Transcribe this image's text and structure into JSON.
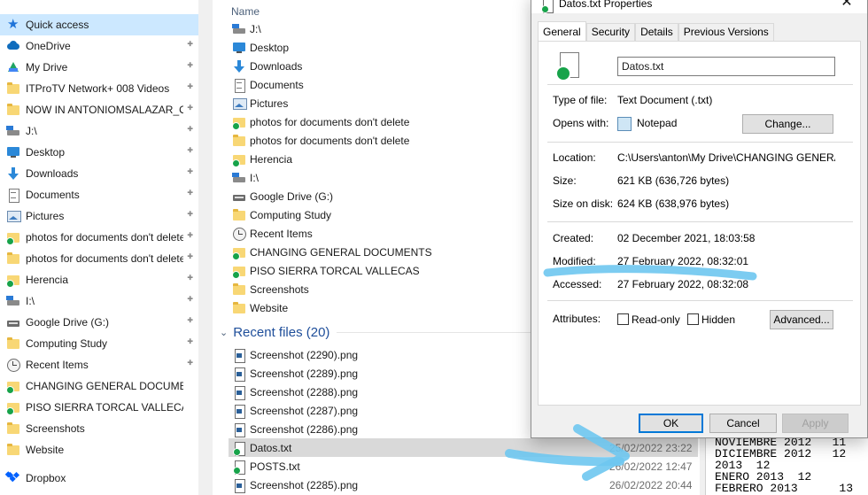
{
  "nav": {
    "items": [
      {
        "label": "Quick access",
        "icon": "star-icon",
        "pinned": false
      },
      {
        "label": "OneDrive",
        "icon": "onedrive-icon",
        "pinned": true
      },
      {
        "label": "My Drive",
        "icon": "google-drive-icon",
        "pinned": true
      },
      {
        "label": "ITProTV Network+ 008 Videos",
        "icon": "folder-icon",
        "pinned": true
      },
      {
        "label": "NOW IN ANTONIOMSALAZAR_OUTLOOK",
        "icon": "folder-icon",
        "pinned": true
      },
      {
        "label": "J:\\",
        "icon": "drive-icon",
        "pinned": true
      },
      {
        "label": "Desktop",
        "icon": "desktop-icon",
        "pinned": true
      },
      {
        "label": "Downloads",
        "icon": "downloads-icon",
        "pinned": true
      },
      {
        "label": "Documents",
        "icon": "documents-icon",
        "pinned": true
      },
      {
        "label": "Pictures",
        "icon": "pictures-icon",
        "pinned": true
      },
      {
        "label": "photos for documents don't delete",
        "icon": "synced-folder-icon",
        "pinned": true
      },
      {
        "label": "photos for documents don't delete",
        "icon": "folder-icon",
        "pinned": true
      },
      {
        "label": "Herencia",
        "icon": "synced-folder-icon",
        "pinned": true
      },
      {
        "label": "I:\\",
        "icon": "drive-icon",
        "pinned": true
      },
      {
        "label": "Google Drive (G:)",
        "icon": "google-drive-disk-icon",
        "pinned": true
      },
      {
        "label": "Computing Study",
        "icon": "folder-icon",
        "pinned": true
      },
      {
        "label": "Recent Items",
        "icon": "recent-items-icon",
        "pinned": true
      },
      {
        "label": "CHANGING GENERAL DOCUMENTS",
        "icon": "synced-folder-icon",
        "pinned": false
      },
      {
        "label": "PISO SIERRA TORCAL VALLECAS",
        "icon": "synced-folder-icon",
        "pinned": false
      },
      {
        "label": "Screenshots",
        "icon": "folder-icon",
        "pinned": false
      },
      {
        "label": "Website",
        "icon": "folder-icon",
        "pinned": false
      },
      {
        "label": "Dropbox",
        "icon": "dropbox-icon",
        "pinned": false
      }
    ]
  },
  "files": {
    "column_name": "Name",
    "frequent": [
      {
        "name": "J:\\",
        "icon": "drive-icon"
      },
      {
        "name": "Desktop",
        "icon": "desktop-icon"
      },
      {
        "name": "Downloads",
        "icon": "downloads-icon"
      },
      {
        "name": "Documents",
        "icon": "documents-icon"
      },
      {
        "name": "Pictures",
        "icon": "pictures-icon"
      },
      {
        "name": "photos for documents don't delete",
        "icon": "synced-folder-icon"
      },
      {
        "name": "photos for documents don't delete",
        "icon": "folder-icon"
      },
      {
        "name": "Herencia",
        "icon": "synced-folder-icon"
      },
      {
        "name": "I:\\",
        "icon": "drive-icon"
      },
      {
        "name": "Google Drive (G:)",
        "icon": "google-drive-disk-icon"
      },
      {
        "name": "Computing Study",
        "icon": "folder-icon"
      },
      {
        "name": "Recent Items",
        "icon": "recent-items-icon"
      },
      {
        "name": "CHANGING GENERAL DOCUMENTS",
        "icon": "synced-folder-icon"
      },
      {
        "name": "PISO SIERRA TORCAL VALLECAS",
        "icon": "synced-folder-icon"
      },
      {
        "name": "Screenshots",
        "icon": "folder-icon"
      },
      {
        "name": "Website",
        "icon": "folder-icon"
      }
    ],
    "recent_header": "Recent files (20)",
    "recent": [
      {
        "name": "Screenshot (2290).png",
        "date": "",
        "icon": "png-file-icon"
      },
      {
        "name": "Screenshot (2289).png",
        "date": "",
        "icon": "png-file-icon"
      },
      {
        "name": "Screenshot (2288).png",
        "date": "",
        "icon": "png-file-icon"
      },
      {
        "name": "Screenshot (2287).png",
        "date": "",
        "icon": "png-file-icon"
      },
      {
        "name": "Screenshot (2286).png",
        "date": "",
        "icon": "png-file-icon"
      },
      {
        "name": "Datos.txt",
        "date": "25/02/2022 23:22",
        "icon": "synced-text-file-icon"
      },
      {
        "name": "POSTS.txt",
        "date": "26/02/2022 12:47",
        "icon": "synced-text-file-icon"
      },
      {
        "name": "Screenshot (2285).png",
        "date": "26/02/2022 20:44",
        "icon": "png-file-icon"
      }
    ]
  },
  "background_text": {
    "lines": [
      "NOVIEMBRE 2012   11",
      "DICIEMBRE 2012   12",
      "2013  12",
      "ENERO 2013  12",
      "FEBRERO 2013      13"
    ]
  },
  "dialog": {
    "title": "Datos.txt Properties",
    "close_glyph": "✕",
    "tabs": [
      "General",
      "Security",
      "Details",
      "Previous Versions"
    ],
    "active_tab": "General",
    "filename": "Datos.txt",
    "type_label": "Type of file:",
    "type_value": "Text Document (.txt)",
    "opens_label": "Opens with:",
    "opens_value": "Notepad",
    "change_button": "Change...",
    "location_label": "Location:",
    "location_value": "C:\\Users\\anton\\My Drive\\CHANGING GENERAL D",
    "size_label": "Size:",
    "size_value": "621 KB (636,726 bytes)",
    "size_on_disk_label": "Size on disk:",
    "size_on_disk_value": "624 KB (638,976 bytes)",
    "created_label": "Created:",
    "created_value": "02 December 2021, 18:03:58",
    "modified_label": "Modified:",
    "modified_value": "27 February 2022, 08:32:01",
    "accessed_label": "Accessed:",
    "accessed_value": "27 February 2022, 08:32:08",
    "attributes_label": "Attributes:",
    "readonly_label": "Read-only",
    "hidden_label": "Hidden",
    "advanced_button": "Advanced...",
    "ok_button": "OK",
    "cancel_button": "Cancel",
    "apply_button": "Apply"
  },
  "colors": {
    "selection": "#cce8ff",
    "row_selected": "#d9d9d9",
    "annotation": "#6ec6f0",
    "group_header": "#1e4e9a"
  }
}
